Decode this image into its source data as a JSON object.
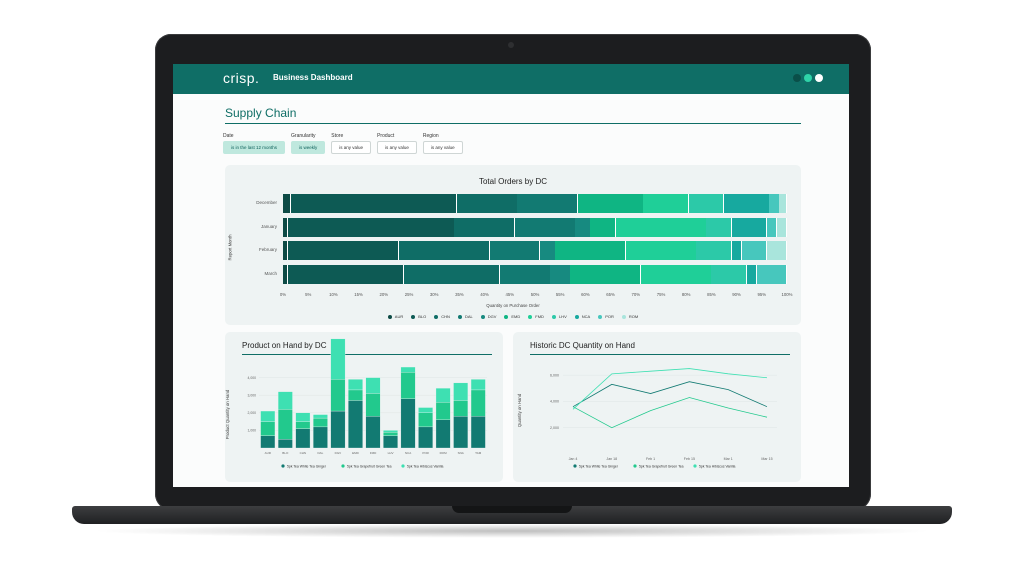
{
  "header": {
    "logo": "crisp.",
    "app_title": "Business Dashboard"
  },
  "header_dots": [
    "#0a4f49",
    "#2fd3a8",
    "#ffffff"
  ],
  "page": {
    "title": "Supply Chain"
  },
  "filters": [
    {
      "label": "Date",
      "value": "is in the last 12 months",
      "active": true
    },
    {
      "label": "Granularity",
      "value": "is weekly",
      "active": true
    },
    {
      "label": "Store",
      "value": "is any value",
      "active": false
    },
    {
      "label": "Product",
      "value": "is any value",
      "active": false
    },
    {
      "label": "Region",
      "value": "is any value",
      "active": false
    }
  ],
  "orders": {
    "title": "Total Orders by DC",
    "ylabel": "Report Month",
    "xlabel": "Quantity on Purchase Order",
    "ticks": [
      "0%",
      "5%",
      "10%",
      "15%",
      "20%",
      "25%",
      "30%",
      "35%",
      "40%",
      "45%",
      "50%",
      "55%",
      "60%",
      "65%",
      "70%",
      "75%",
      "80%",
      "85%",
      "90%",
      "95%",
      "100%"
    ]
  },
  "onhand": {
    "title": "Product on Hand by DC",
    "ylabel": "Product Quantity on Hand",
    "yticks": [
      "4,000",
      "3,000",
      "2,000",
      "1,000"
    ],
    "xticks": [
      "AUR",
      "BLO",
      "CHN",
      "DAL",
      "DGV",
      "EMD",
      "FMD",
      "LHV",
      "NCA",
      "POR",
      "ROM",
      "SNA",
      "TAM"
    ]
  },
  "history": {
    "title": "Historic DC Quantity on Hand",
    "ylabel": "Quantity on Hand",
    "yticks": [
      "6,000",
      "4,000",
      "2,000"
    ],
    "xticks": [
      "Jan 4",
      "Jan 18",
      "Feb 1",
      "Feb 15",
      "Mar 1",
      "Mar 15"
    ]
  },
  "colors": {
    "AUR": "#0d4a45",
    "BLO": "#0d5a54",
    "CHN": "#0f6d66",
    "DAL": "#127a72",
    "DGV": "#178a80",
    "EMD": "#0fb583",
    "FMD": "#1fcf98",
    "LHV": "#2cc9a8",
    "NCA": "#17a99f",
    "POR": "#47c7bd",
    "ROM": "#a9e5dc",
    "white_ginger": "#127a72",
    "grapefruit": "#22c98d",
    "hibiscus": "#3ee0b2"
  },
  "chart_data": [
    {
      "type": "bar",
      "orientation": "horizontal",
      "stacked": "percent",
      "title": "Total Orders by DC",
      "xlabel": "Quantity on Purchase Order",
      "ylabel": "Report Month",
      "categories": [
        "December",
        "January",
        "February",
        "March"
      ],
      "xlim": [
        0,
        100
      ],
      "legend_position": "bottom",
      "series": [
        {
          "name": "AUR",
          "values": [
            1.5,
            1.0,
            1.0,
            1.0
          ]
        },
        {
          "name": "BLO",
          "values": [
            33,
            33,
            22,
            23
          ]
        },
        {
          "name": "CHN",
          "values": [
            12,
            12,
            18,
            19
          ]
        },
        {
          "name": "DAL",
          "values": [
            12,
            12,
            10,
            10
          ]
        },
        {
          "name": "DGV",
          "values": [
            0,
            3,
            3,
            4
          ]
        },
        {
          "name": "EMD",
          "values": [
            13,
            5,
            14,
            14
          ]
        },
        {
          "name": "FMD",
          "values": [
            9,
            18,
            14,
            14
          ]
        },
        {
          "name": "LHV",
          "values": [
            7,
            5,
            7,
            7
          ]
        },
        {
          "name": "NCA",
          "values": [
            9,
            7,
            2,
            2
          ]
        },
        {
          "name": "POR",
          "values": [
            2,
            2,
            5,
            6
          ]
        },
        {
          "name": "ROM",
          "values": [
            1.5,
            2,
            4,
            0
          ]
        }
      ]
    },
    {
      "type": "bar",
      "stacked": true,
      "title": "Product on Hand by DC",
      "ylabel": "Product Quantity on Hand",
      "categories": [
        "AUR",
        "BLO",
        "CHN",
        "DAL",
        "DGV",
        "EMD",
        "FMD",
        "LHV",
        "NCA",
        "POR",
        "ROM",
        "SNA",
        "TAM"
      ],
      "ylim": [
        0,
        5000
      ],
      "legend_position": "bottom",
      "series": [
        {
          "name": "5pk Tea White Tea Ginger",
          "values": [
            700,
            500,
            1100,
            1200,
            2100,
            2700,
            1800,
            700,
            2800,
            1200,
            1600,
            1800,
            1800
          ]
        },
        {
          "name": "5pk Tea Grapefruit Green Tea",
          "values": [
            800,
            1700,
            400,
            500,
            1800,
            600,
            1300,
            200,
            1500,
            800,
            1000,
            900,
            1500
          ]
        },
        {
          "name": "5pk Tea Hibiscus Vanilla",
          "values": [
            600,
            1000,
            500,
            200,
            2300,
            600,
            900,
            100,
            300,
            300,
            800,
            1000,
            600
          ]
        }
      ]
    },
    {
      "type": "line",
      "title": "Historic DC Quantity on Hand",
      "ylabel": "Quantity on Hand",
      "x": [
        "Jan 4",
        "Jan 18",
        "Feb 1",
        "Feb 15",
        "Mar 1",
        "Mar 15"
      ],
      "ylim": [
        0,
        7000
      ],
      "legend_position": "bottom",
      "series": [
        {
          "name": "5pk Tea White Tea Ginger",
          "values": [
            3600,
            5300,
            4600,
            5500,
            4900,
            3600
          ]
        },
        {
          "name": "5pk Tea Grapefruit Green Tea",
          "values": [
            3600,
            2000,
            3300,
            4300,
            3500,
            2800
          ]
        },
        {
          "name": "5pk Tea Hibiscus Vanilla",
          "values": [
            3400,
            6100,
            6300,
            6500,
            6100,
            5800
          ]
        }
      ]
    }
  ]
}
